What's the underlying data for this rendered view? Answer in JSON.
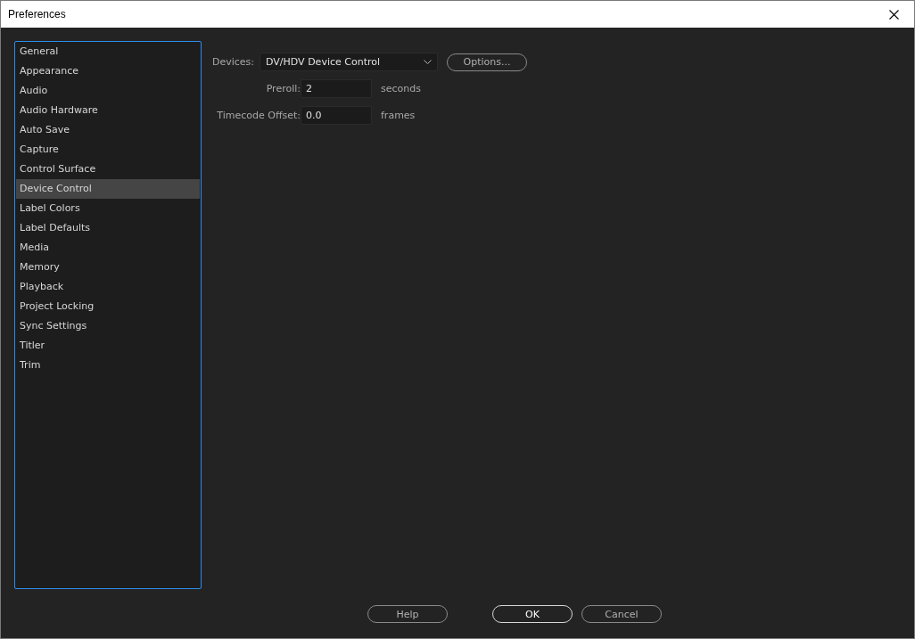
{
  "window": {
    "title": "Preferences"
  },
  "sidebar": {
    "items": [
      {
        "label": "General",
        "selected": false
      },
      {
        "label": "Appearance",
        "selected": false
      },
      {
        "label": "Audio",
        "selected": false
      },
      {
        "label": "Audio Hardware",
        "selected": false
      },
      {
        "label": "Auto Save",
        "selected": false
      },
      {
        "label": "Capture",
        "selected": false
      },
      {
        "label": "Control Surface",
        "selected": false
      },
      {
        "label": "Device Control",
        "selected": true
      },
      {
        "label": "Label Colors",
        "selected": false
      },
      {
        "label": "Label Defaults",
        "selected": false
      },
      {
        "label": "Media",
        "selected": false
      },
      {
        "label": "Memory",
        "selected": false
      },
      {
        "label": "Playback",
        "selected": false
      },
      {
        "label": "Project Locking",
        "selected": false
      },
      {
        "label": "Sync Settings",
        "selected": false
      },
      {
        "label": "Titler",
        "selected": false
      },
      {
        "label": "Trim",
        "selected": false
      }
    ]
  },
  "devices": {
    "label": "Devices:",
    "value": "DV/HDV Device Control",
    "options_button": "Options..."
  },
  "fields": [
    {
      "label": "Preroll:",
      "value": "2",
      "unit": "seconds"
    },
    {
      "label": "Timecode Offset:",
      "value": "0.0",
      "unit": "frames"
    }
  ],
  "buttons": [
    {
      "label": "Help",
      "default": false
    },
    {
      "label": "OK",
      "default": true
    },
    {
      "label": "Cancel",
      "default": false
    }
  ]
}
